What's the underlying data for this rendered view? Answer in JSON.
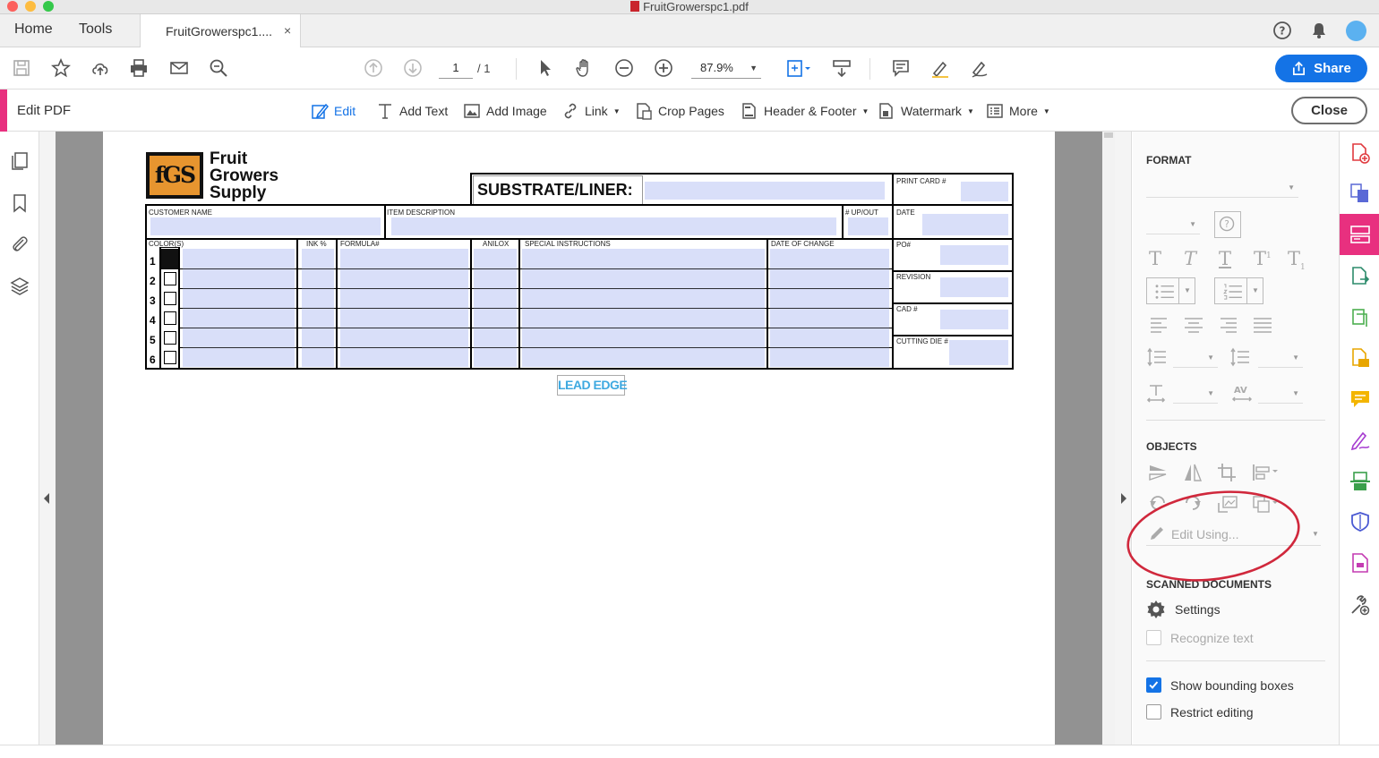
{
  "window": {
    "title": "FruitGrowerspc1.pdf"
  },
  "tabs": {
    "home": "Home",
    "tools": "Tools",
    "document": "FruitGrowerspc1....",
    "close": "×"
  },
  "toolbar": {
    "page_current": "1",
    "page_total": "/ 1",
    "zoom": "87.9%",
    "share_label": "Share"
  },
  "editbar": {
    "title": "Edit PDF",
    "items": [
      "Edit",
      "Add Text",
      "Add Image",
      "Link",
      "Crop Pages",
      "Header & Footer",
      "Watermark",
      "More"
    ],
    "close_label": "Close",
    "accent": "#e8307f"
  },
  "form": {
    "logo_mark": "fGS",
    "logo_line1": "Fruit",
    "logo_line2": "Growers",
    "logo_line3": "Supply",
    "substrate_label": "SUBSTRATE/LINER:",
    "print_card": "PRINT CARD #",
    "customer_name": "CUSTOMER NAME",
    "item_description": "ITEM DESCRIPTION",
    "up_out": "# UP/OUT",
    "date": "DATE",
    "colors": "COLOR(S)",
    "ink": "INK %",
    "formula": "FORMULA#",
    "anilox": "ANILOX",
    "special_instructions": "SPECIAL INSTRUCTIONS",
    "date_of_change": "DATE OF CHANGE",
    "po": "PO#",
    "revision": "REVISION",
    "cad": "CAD #",
    "cutting_die": "CUTTING DIE #",
    "rows": [
      "1",
      "2",
      "3",
      "4",
      "5",
      "6"
    ],
    "lead_edge": "LEAD EDGE"
  },
  "panel": {
    "format_heading": "FORMAT",
    "objects_heading": "OBJECTS",
    "edit_using": "Edit Using...",
    "scanned_heading": "SCANNED DOCUMENTS",
    "settings_label": "Settings",
    "recognize_text": "Recognize text",
    "show_bounding_boxes": "Show bounding boxes",
    "show_bounding_boxes_checked": true,
    "restrict_editing": "Restrict editing",
    "restrict_editing_checked": false
  },
  "colors": {
    "brand_blue": "#1473e6",
    "field_fill": "#d9dff9",
    "annotation_red": "#d0283c"
  }
}
